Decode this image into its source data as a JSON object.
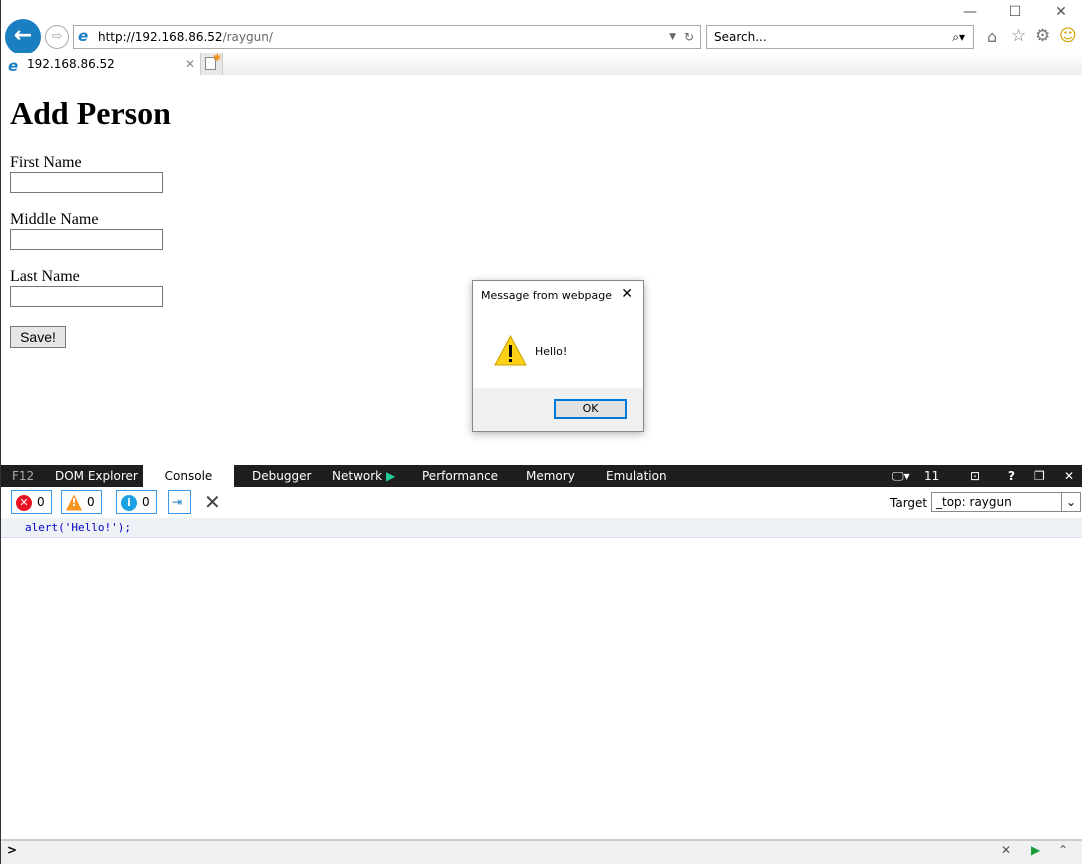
{
  "browser": {
    "url_host": "http://192.168.86.52",
    "url_path": "/raygun/",
    "search_placeholder": "Search...",
    "tab_title": "192.168.86.52",
    "icons": [
      "back-arrow-icon",
      "forward-arrow-icon",
      "ie-logo-icon",
      "refresh-icon",
      "search-icon",
      "home-icon",
      "star-icon",
      "gear-icon",
      "smiley-icon"
    ]
  },
  "page": {
    "title": "Add Person",
    "fields": [
      {
        "label": "First Name",
        "value": ""
      },
      {
        "label": "Middle Name",
        "value": ""
      },
      {
        "label": "Last Name",
        "value": ""
      }
    ],
    "save_label": "Save!"
  },
  "dialog": {
    "title": "Message from webpage",
    "message": "Hello!",
    "ok_label": "OK",
    "icon": "warning-icon"
  },
  "devtools": {
    "f12": "F12",
    "tabs": [
      "DOM Explorer",
      "Console",
      "Debugger",
      "Network",
      "Performance",
      "Memory",
      "Emulation"
    ],
    "active_tab": "Console",
    "doc_mode": "11",
    "counts": {
      "errors": "0",
      "warnings": "0",
      "info": "0"
    },
    "target_label": "Target",
    "target_value": "_top: raygun",
    "console_lines": [
      "alert('Hello!');"
    ],
    "prompt": ">"
  },
  "colors": {
    "accent": "#1a7fc1",
    "devbar": "#1e1e1e",
    "error": "#e81123",
    "warning": "#f7931e",
    "info": "#1ba1e2"
  }
}
